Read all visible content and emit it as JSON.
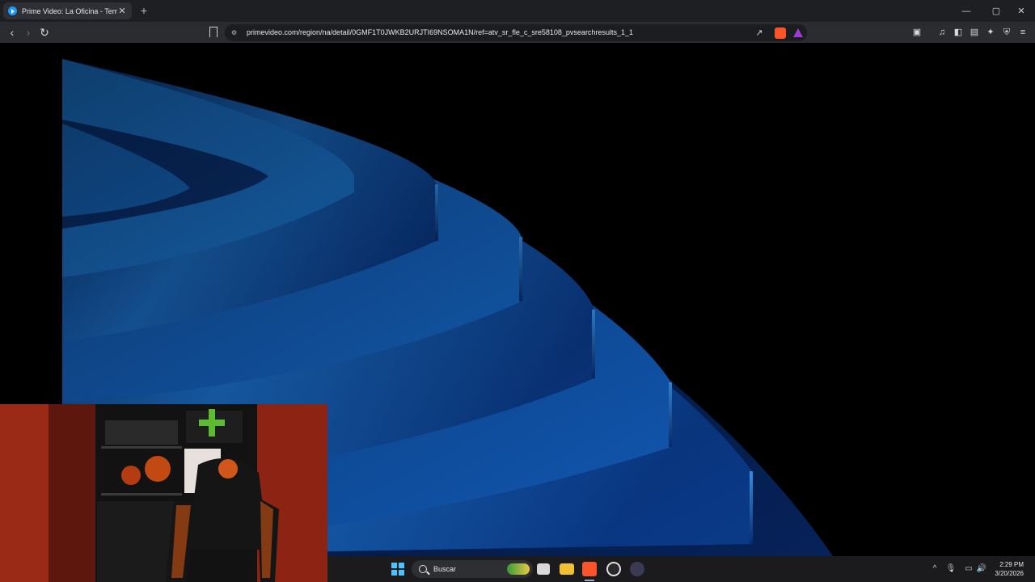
{
  "tab": {
    "title": "Prime Video: La Oficina - Tempo",
    "close": "✕"
  },
  "newtab_label": "+",
  "window_controls": {
    "minimize": "—",
    "maximize": "▢",
    "close": "✕"
  },
  "address_bar": {
    "url": "primevideo.com/region/na/detail/0GMF1T0JWKB2URJTI69NSOMA1N/ref=atv_sr_fle_c_sre58108_pvsearchresults_1_1"
  },
  "taskbar": {
    "search_label": "Buscar",
    "time": "2:29 PM",
    "date": "3/20/2026"
  },
  "colors": {
    "accent": "#1a98ff",
    "background": "#000000",
    "webcam_wall": "#8f2414",
    "chair_accent": "#e05a10"
  }
}
